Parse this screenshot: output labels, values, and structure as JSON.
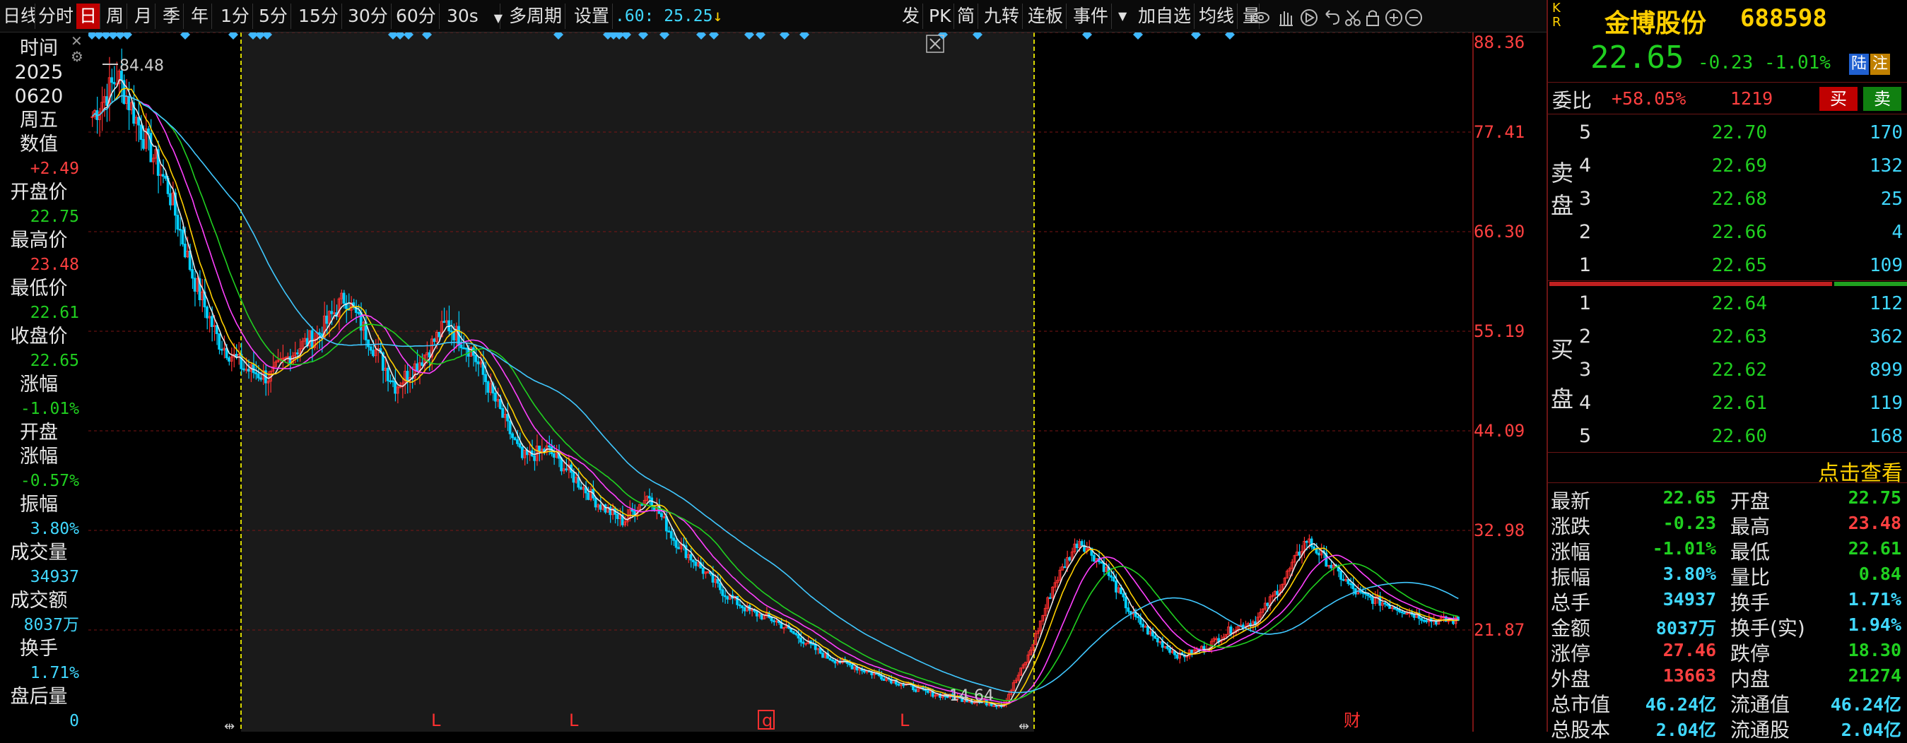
{
  "toolbar": {
    "period_first": "日线",
    "items": [
      "分时",
      "日",
      "周",
      "月",
      "季",
      "年",
      "1分",
      "5分",
      "15分",
      "30分",
      "60分",
      "30s",
      "多周期",
      "设置"
    ],
    "ma_readout": ".60: 25.25",
    "right_items": [
      "发",
      "PK",
      "简",
      "九转",
      "连板",
      "事件",
      "加自选",
      "均线",
      "量"
    ],
    "dropdown": "▼"
  },
  "info": {
    "time_label": "时间",
    "year": "2025",
    "date": "0620",
    "weekday": "周五",
    "value_label": "数值",
    "value": "+2.49",
    "open_label": "开盘价",
    "open": "22.75",
    "high_label": "最高价",
    "high": "23.48",
    "low_label": "最低价",
    "low": "22.61",
    "close_label": "收盘价",
    "close": "22.65",
    "chg_label": "涨幅",
    "chg": "-1.01%",
    "open_chg_label1": "开盘",
    "open_chg_label2": "涨幅",
    "open_chg": "-0.57%",
    "amp_label": "振幅",
    "amp": "3.80%",
    "vol_label": "成交量",
    "vol": "34937",
    "amt_label": "成交额",
    "amt": "8037万",
    "turn_label": "换手",
    "turn": "1.71%",
    "after_label": "盘后量",
    "after": "0"
  },
  "chart": {
    "axis_labels": [
      "88.36",
      "77.41",
      "66.30",
      "55.19",
      "44.09",
      "32.98",
      "21.87"
    ],
    "axis_max": 88.36,
    "axis_min": 21.87,
    "high_marker": "84.48",
    "low_marker": "14.64",
    "bottom_markers": [
      "L",
      "L",
      "q",
      "L",
      "财"
    ],
    "colors": {
      "up": "#ff3030",
      "down": "#00d0ff",
      "ma5": "#e8e8e8",
      "ma10": "#ffd000",
      "ma20": "#ff40ff",
      "ma30": "#20d020",
      "ma60": "#40c8ff",
      "grid": "#7a1515"
    }
  },
  "chart_data": {
    "type": "line",
    "title": "",
    "ylim": [
      14.64,
      88.36
    ],
    "series": [
      {
        "name": "",
        "values": [
          80,
          84.48,
          78,
          72,
          62,
          55,
          52,
          51,
          54,
          56,
          60,
          55,
          50,
          53,
          57,
          54,
          48,
          42,
          43,
          40,
          37,
          35,
          38,
          33,
          30,
          27,
          25,
          24,
          22,
          20,
          19,
          18,
          17,
          16,
          15.5,
          15,
          14.64,
          20,
          28,
          33,
          30,
          25,
          22,
          20,
          21,
          23,
          24,
          28,
          33,
          30,
          27,
          26,
          25,
          24,
          24
        ]
      }
    ]
  },
  "quote": {
    "kr": [
      "K",
      "R"
    ],
    "name": "金博股份",
    "code": "688598",
    "price": "22.65",
    "change": "-0.23",
    "change_pct": "-1.01%",
    "tag1": "陆",
    "tag2": "注",
    "weibi_label": "委比",
    "weibi": "+58.05%",
    "weicha": "1219",
    "buy_btn": "买",
    "sell_btn": "卖",
    "sell_side": [
      "卖",
      "盘"
    ],
    "buy_side": [
      "买",
      "盘"
    ],
    "asks": [
      {
        "lvl": "5",
        "price": "22.70",
        "vol": "170"
      },
      {
        "lvl": "4",
        "price": "22.69",
        "vol": "132"
      },
      {
        "lvl": "3",
        "price": "22.68",
        "vol": "25"
      },
      {
        "lvl": "2",
        "price": "22.66",
        "vol": "4"
      },
      {
        "lvl": "1",
        "price": "22.65",
        "vol": "109"
      }
    ],
    "bids": [
      {
        "lvl": "1",
        "price": "22.64",
        "vol": "112"
      },
      {
        "lvl": "2",
        "price": "22.63",
        "vol": "362"
      },
      {
        "lvl": "3",
        "price": "22.62",
        "vol": "899"
      },
      {
        "lvl": "4",
        "price": "22.61",
        "vol": "119"
      },
      {
        "lvl": "5",
        "price": "22.60",
        "vol": "168"
      }
    ],
    "click_view": "点击查看",
    "stats": [
      {
        "l1": "最新",
        "v1": "22.65",
        "c1": "green",
        "l2": "开盘",
        "v2": "22.75",
        "c2": "green"
      },
      {
        "l1": "涨跌",
        "v1": "-0.23",
        "c1": "green",
        "l2": "最高",
        "v2": "23.48",
        "c2": "red"
      },
      {
        "l1": "涨幅",
        "v1": "-1.01%",
        "c1": "green",
        "l2": "最低",
        "v2": "22.61",
        "c2": "green"
      },
      {
        "l1": "振幅",
        "v1": "3.80%",
        "c1": "cyan",
        "l2": "量比",
        "v2": "0.84",
        "c2": "green"
      },
      {
        "l1": "总手",
        "v1": "34937",
        "c1": "cyan",
        "l2": "换手",
        "v2": "1.71%",
        "c2": "cyan"
      },
      {
        "l1": "金额",
        "v1": "8037万",
        "c1": "cyan",
        "l2": "换手(实)",
        "v2": "1.94%",
        "c2": "cyan"
      },
      {
        "l1": "涨停",
        "v1": "27.46",
        "c1": "red",
        "l2": "跌停",
        "v2": "18.30",
        "c2": "green"
      },
      {
        "l1": "外盘",
        "v1": "13663",
        "c1": "red",
        "l2": "内盘",
        "v2": "21274",
        "c2": "green"
      },
      {
        "l1": "总市值",
        "v1": "46.24亿",
        "c1": "cyan",
        "l2": "流通值",
        "v2": "46.24亿",
        "c2": "cyan"
      },
      {
        "l1": "总股本",
        "v1": "2.04亿",
        "c1": "cyan",
        "l2": "流通股",
        "v2": "2.04亿",
        "c2": "cyan"
      }
    ]
  }
}
